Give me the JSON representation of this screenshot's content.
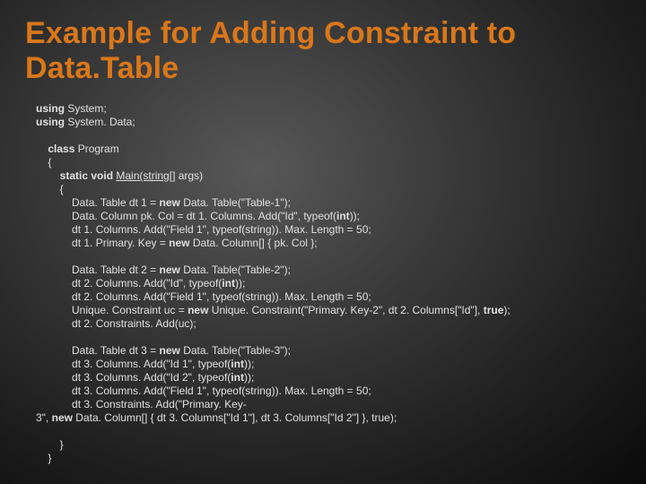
{
  "title_line1": "Example for Adding Constraint to",
  "title_line2": "Data.Table",
  "code": {
    "l01a": "using",
    "l01b": " System;",
    "l02a": "using",
    "l02b": " System. Data;",
    "l03a": "class",
    "l03b": " Program",
    "l04": "{",
    "l05a": "static void",
    "l05b": " ",
    "l05c": "Main",
    "l05d": "(string[]",
    "l05e": " args)",
    "l06": "{",
    "l07a": "Data. Table dt 1 = ",
    "l07b": "new",
    "l07c": " Data. Table(\"Table-1\");",
    "l08a": "Data. Column pk. Col = dt 1. Columns. Add(\"Id\", typeof(",
    "l08b": "int",
    "l08c": "));",
    "l09": "dt 1. Columns. Add(\"Field 1\", typeof(string)). Max. Length = 50;",
    "l10a": "dt 1. Primary. Key = ",
    "l10b": "new",
    "l10c": " Data. Column[] { pk. Col };",
    "l11a": "Data. Table dt 2 = ",
    "l11b": "new",
    "l11c": " Data. Table(\"Table-2\");",
    "l12a": "dt 2. Columns. Add(\"Id\", typeof(",
    "l12b": "int",
    "l12c": "));",
    "l13": "dt 2. Columns. Add(\"Field 1\", typeof(string)). Max. Length = 50;",
    "l14a": "Unique. Constraint uc = ",
    "l14b": "new",
    "l14c": " Unique. Constraint(\"Primary. Key-2\", dt 2. Columns[\"Id\"], ",
    "l14d": "true",
    "l14e": ");",
    "l15": "dt 2. Constraints. Add(uc);",
    "l16a": "Data. Table dt 3 = ",
    "l16b": "new",
    "l16c": " Data. Table(\"Table-3\");",
    "l17a": "dt 3. Columns. Add(\"Id 1\", typeof(",
    "l17b": "int",
    "l17c": "));",
    "l18a": "dt 3. Columns. Add(\"Id 2\", typeof(",
    "l18b": "int",
    "l18c": "));",
    "l19": "dt 3. Columns. Add(\"Field 1\", typeof(string)). Max. Length = 50;",
    "l20": "dt 3. Constraints. Add(\"Primary. Key-",
    "l21a": "3\", ",
    "l21b": "new",
    "l21c": " Data. Column[] { dt 3. Columns[\"Id 1\"], dt 3. Columns[\"Id 2\"] }, true);",
    "l22": "}",
    "l23": "}"
  }
}
